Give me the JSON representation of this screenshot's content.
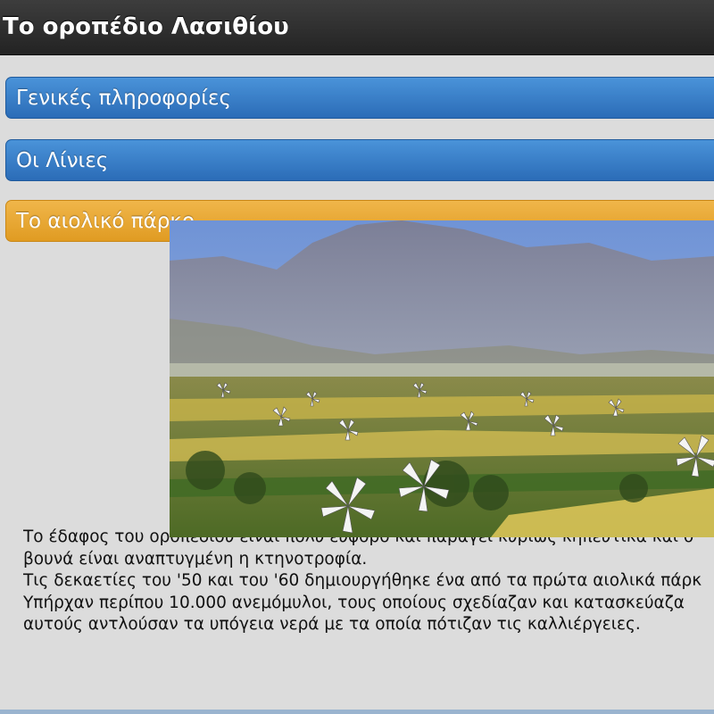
{
  "header": {
    "title": "Το οροπέδιο Λασιθίου"
  },
  "sections": [
    {
      "label": "Γενικές πληροφορίες",
      "state": "collapsed"
    },
    {
      "label": "Οι Λίνιες",
      "state": "collapsed"
    },
    {
      "label": "Το αιολικό πάρκο",
      "state": "expanded"
    }
  ],
  "content": {
    "lines": [
      "Το έδαφος του οροπεδίου είναι πολύ εύφορο και παράγει κυρίως κηπευτικά και ο",
      "βουνά είναι αναπτυγμένη η κτηνοτροφία.",
      "Τις δεκαετίες του '50 και του '60 δημιουργήθηκε ένα από τα πρώτα αιολικά πάρκ",
      "Υπήρχαν περίπου 10.000 ανεμόμυλοι, τους οποίους σχεδίαζαν και κατασκεύαζα",
      "αυτούς αντλούσαν τα υπόγεια νερά με τα οποία πότιζαν τις καλλιέργειες."
    ]
  },
  "image": {
    "subject": "windmills-plateau-photo"
  },
  "colors": {
    "header_bg": "#2e2e2e",
    "section_blue": "#3a80c9",
    "section_active": "#e8a934",
    "page_bg": "#dcdcdc"
  }
}
